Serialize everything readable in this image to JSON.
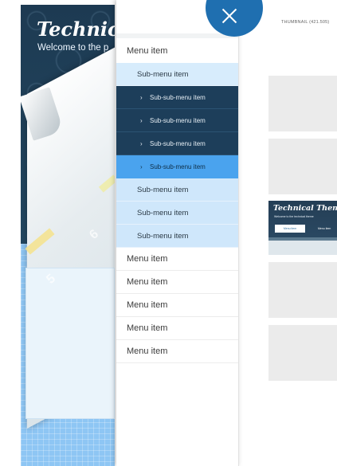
{
  "hero": {
    "brand": "Technical",
    "tagline": "Welcome to the p",
    "ruler_numbers": [
      "5",
      "6"
    ]
  },
  "menu": {
    "close_icon": "close-icon",
    "items": [
      {
        "label": "Menu item",
        "level": 1
      },
      {
        "label": "Sub-menu item",
        "level": 2
      },
      {
        "label": "Sub-sub-menu item",
        "level": 3
      },
      {
        "label": "Sub-sub-menu item",
        "level": 3
      },
      {
        "label": "Sub-sub-menu item",
        "level": 3
      },
      {
        "label": "Sub-sub-menu item",
        "level": 3,
        "active": true
      },
      {
        "label": "Sub-menu item",
        "level": 2
      },
      {
        "label": "Sub-menu item",
        "level": 2
      },
      {
        "label": "Sub-menu item",
        "level": 2
      },
      {
        "label": "Menu item",
        "level": 1
      },
      {
        "label": "Menu item",
        "level": 1
      },
      {
        "label": "Menu item",
        "level": 1
      },
      {
        "label": "Menu item",
        "level": 1
      },
      {
        "label": "Menu item",
        "level": 1
      }
    ],
    "chevron": "›"
  },
  "thumbnails": {
    "label": "THUMBNAIL (421.505)",
    "preview": {
      "brand": "Technical Theme",
      "tagline": "Welcome to the technical theme",
      "button": "Menu item",
      "link": "Menu item"
    }
  },
  "colors": {
    "accent": "#1f6fb0",
    "submenu_bg": "#cfe7fb",
    "subsub_bg": "#1d3e5a",
    "active_bg": "#4aa3ee"
  }
}
